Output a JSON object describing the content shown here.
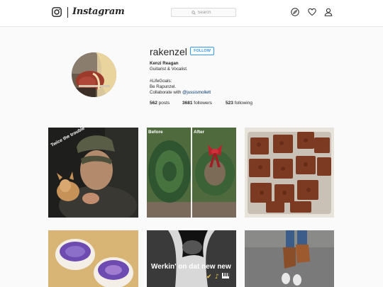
{
  "nav": {
    "logo_text": "Instagram",
    "search_placeholder": "Search",
    "icons": [
      "camera-icon",
      "compass-icon",
      "heart-icon",
      "user-icon"
    ]
  },
  "profile": {
    "username": "rakenzel",
    "follow_label": "FOLLOW",
    "full_name": "Kenzi Reagan",
    "bio_line1": "Guitarist & Vocalist.",
    "bio_line2": "#LifeGoals:",
    "bio_line3": "Be Rapunzel.",
    "bio_collab_prefix": "Collaborate with ",
    "bio_collab_mention": "@jussismollett",
    "stats": {
      "posts_count": "562",
      "posts_label": " posts",
      "followers_count": "3681",
      "followers_label": " followers",
      "following_count": "523",
      "following_label": " following"
    }
  },
  "posts": {
    "post1_caption": "Twice the trouble",
    "post2_before": "Before",
    "post2_after": "After",
    "post5_caption": "Werkin' on dat new new"
  },
  "colors": {
    "accent": "#3897f0",
    "text": "#262626",
    "background": "#fafafa",
    "border": "#dbdbdb",
    "mention": "#003569"
  }
}
